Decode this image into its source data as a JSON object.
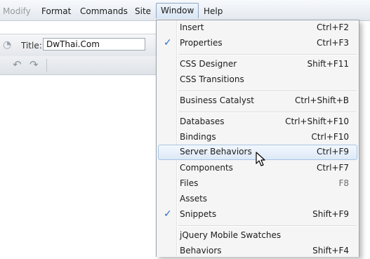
{
  "menubar": {
    "items": [
      "Modify",
      "Format",
      "Commands",
      "Site",
      "Window",
      "Help"
    ]
  },
  "toolbar": {
    "title_label": "Title:",
    "title_value": "DwThai.Com"
  },
  "window_menu": {
    "items": [
      {
        "label": "Insert",
        "shortcut": "Ctrl+F2",
        "checked": false
      },
      {
        "label": "Properties",
        "shortcut": "Ctrl+F3",
        "checked": true
      },
      {
        "label": "CSS Designer",
        "shortcut": "Shift+F11",
        "checked": false
      },
      {
        "label": "CSS Transitions",
        "shortcut": "",
        "checked": false
      },
      {
        "label": "Business Catalyst",
        "shortcut": "Ctrl+Shift+B",
        "checked": false
      },
      {
        "label": "Databases",
        "shortcut": "Ctrl+Shift+F10",
        "checked": false
      },
      {
        "label": "Bindings",
        "shortcut": "Ctrl+F10",
        "checked": false
      },
      {
        "label": "Server Behaviors",
        "shortcut": "Ctrl+F9",
        "checked": false,
        "highlighted": true
      },
      {
        "label": "Components",
        "shortcut": "Ctrl+F7",
        "checked": false
      },
      {
        "label": "Files",
        "shortcut": "F8",
        "checked": false
      },
      {
        "label": "Assets",
        "shortcut": "",
        "checked": false
      },
      {
        "label": "Snippets",
        "shortcut": "Shift+F9",
        "checked": true
      },
      {
        "label": "jQuery Mobile Swatches",
        "shortcut": "",
        "checked": false
      },
      {
        "label": "Behaviors",
        "shortcut": "Shift+F4",
        "checked": false
      }
    ]
  },
  "colors": {
    "accent_check": "#2a6ec8",
    "highlight_border": "#a8c4e4"
  }
}
